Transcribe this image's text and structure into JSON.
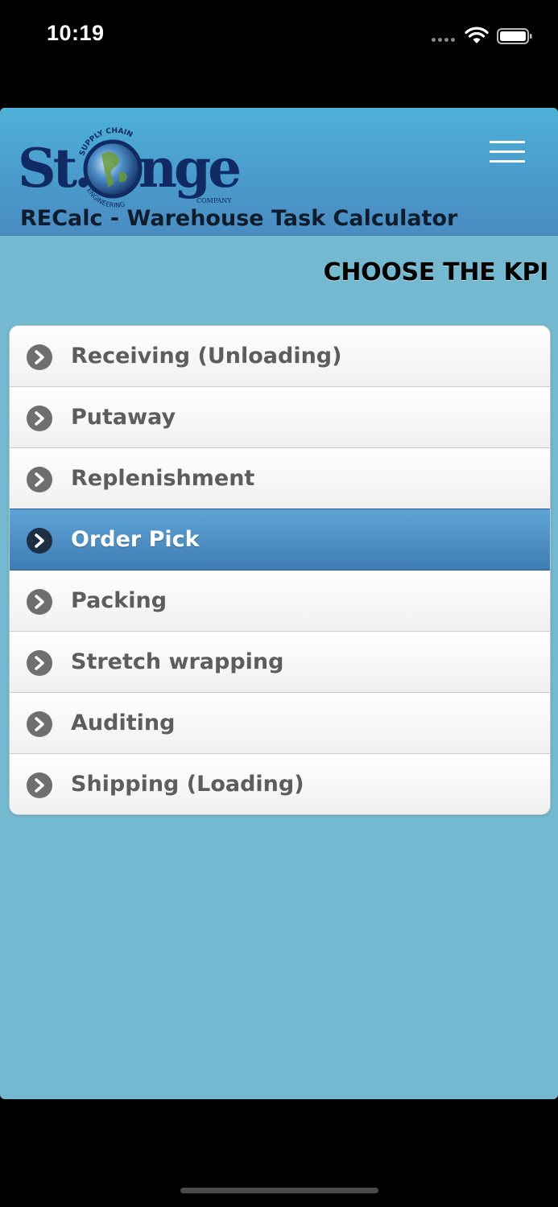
{
  "status_bar": {
    "time": "10:19"
  },
  "header": {
    "logo_text": "St.Onge",
    "logo_tagline_top": "SUPPLY CHAIN",
    "logo_tagline_bottom": "ENGINEERING",
    "logo_company": "COMPANY",
    "title": "RECalc - Warehouse Task Calculator",
    "menu_icon": "hamburger-menu-icon"
  },
  "main": {
    "heading": "CHOOSE THE KPI",
    "kpi_items": [
      {
        "label": "Receiving (Unloading)",
        "icon": "chevron-right-circle-icon",
        "selected": false
      },
      {
        "label": "Putaway",
        "icon": "chevron-right-circle-icon",
        "selected": false
      },
      {
        "label": "Replenishment",
        "icon": "chevron-right-circle-icon",
        "selected": false
      },
      {
        "label": "Order Pick",
        "icon": "chevron-right-circle-icon",
        "selected": true
      },
      {
        "label": "Packing",
        "icon": "chevron-right-circle-icon",
        "selected": false
      },
      {
        "label": "Stretch wrapping",
        "icon": "chevron-right-circle-icon",
        "selected": false
      },
      {
        "label": "Auditing",
        "icon": "chevron-right-circle-icon",
        "selected": false
      },
      {
        "label": "Shipping (Loading)",
        "icon": "chevron-right-circle-icon",
        "selected": false
      }
    ]
  },
  "colors": {
    "app_background": "#74b9d0",
    "header_gradient_top": "#4eb1d6",
    "header_gradient_bottom": "#4a8cc2",
    "selected_item": "#3f7cb4",
    "item_text": "#5d5d5d"
  }
}
